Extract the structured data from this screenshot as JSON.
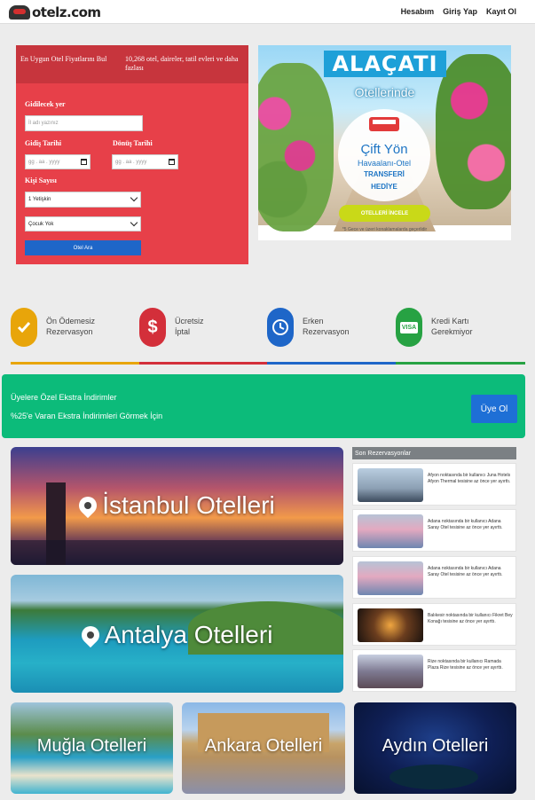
{
  "header": {
    "logo_text": "otelz.com",
    "nav": [
      "Hesabım",
      "Giriş Yap",
      "Kayıt Ol"
    ]
  },
  "search": {
    "top_left": "En Uygun Otel Fiyatlarını Bul",
    "top_right": "10,268 otel, daireler, tatil evleri ve daha fazlası",
    "destination_label": "Gidilecek yer",
    "destination_placeholder": "İl adı yazınız",
    "checkin_label": "Gidiş Tarihi",
    "checkout_label": "Dönüş Tarihi",
    "date_placeholder": "gg . aa . yyyy",
    "guests_label": "Kişi Sayısı",
    "adults_value": "1 Yetişkin",
    "children_value": "Çocuk Yok",
    "button": "Otel Ara"
  },
  "banner": {
    "title": "ALAÇATI",
    "subtitle": "Otellerinde",
    "line1": "Çift Yön",
    "line2": "Havaalanı-Otel",
    "line3": "TRANSFERİ",
    "line4": "HEDİYE",
    "button": "OTELLERİ İNCELE",
    "note": "*5 Gece ve üzeri konaklamalarda geçerlidir"
  },
  "features": [
    {
      "line1": "Ön Ödemesiz",
      "line2": "Rezervasyon",
      "icon": "check-icon",
      "color": "#e8a50a"
    },
    {
      "line1": "Ücretsiz",
      "line2": "İptal",
      "icon": "dollar-icon",
      "color": "#d32f3a"
    },
    {
      "line1": "Erken",
      "line2": "Rezervasyon",
      "icon": "clock-icon",
      "color": "#1e66c8"
    },
    {
      "line1": "Kredi Kartı",
      "line2": "Gerekmiyor",
      "icon": "visa-card-icon",
      "color": "#27a243"
    }
  ],
  "members_promo": {
    "line1": "Üyelere Özel Ekstra İndirimler",
    "line2": "%25'e Varan Ekstra İndirimleri Görmek İçin",
    "button": "Üye Ol",
    "color": "#0cbb7a"
  },
  "cities": {
    "istanbul": "İstanbul Otelleri",
    "antalya": "Antalya Otelleri",
    "mugla": "Muğla Otelleri",
    "ankara": "Ankara Otelleri",
    "aydin": "Aydın Otelleri"
  },
  "recent": {
    "title": "Son Rezervasyonlar",
    "items": [
      "Afyon noktasında bir kullanıcı Juna Hotels Afyon Thermal tesisine az önce yer ayırttı.",
      "Adana noktasında bir kullanıcı Adana Saray Otel tesisine az önce yer ayırttı.",
      "Adana noktasında bir kullanıcı Adana Saray Otel tesisine az önce yer ayırttı.",
      "Balıkesir noktasında bir kullanıcı Fikret Bey Konağı tesisine az önce yer ayırttı.",
      "Rize noktasında bir kullanıcı Ramada Plaza Rize tesisine az önce yer ayırttı."
    ]
  }
}
